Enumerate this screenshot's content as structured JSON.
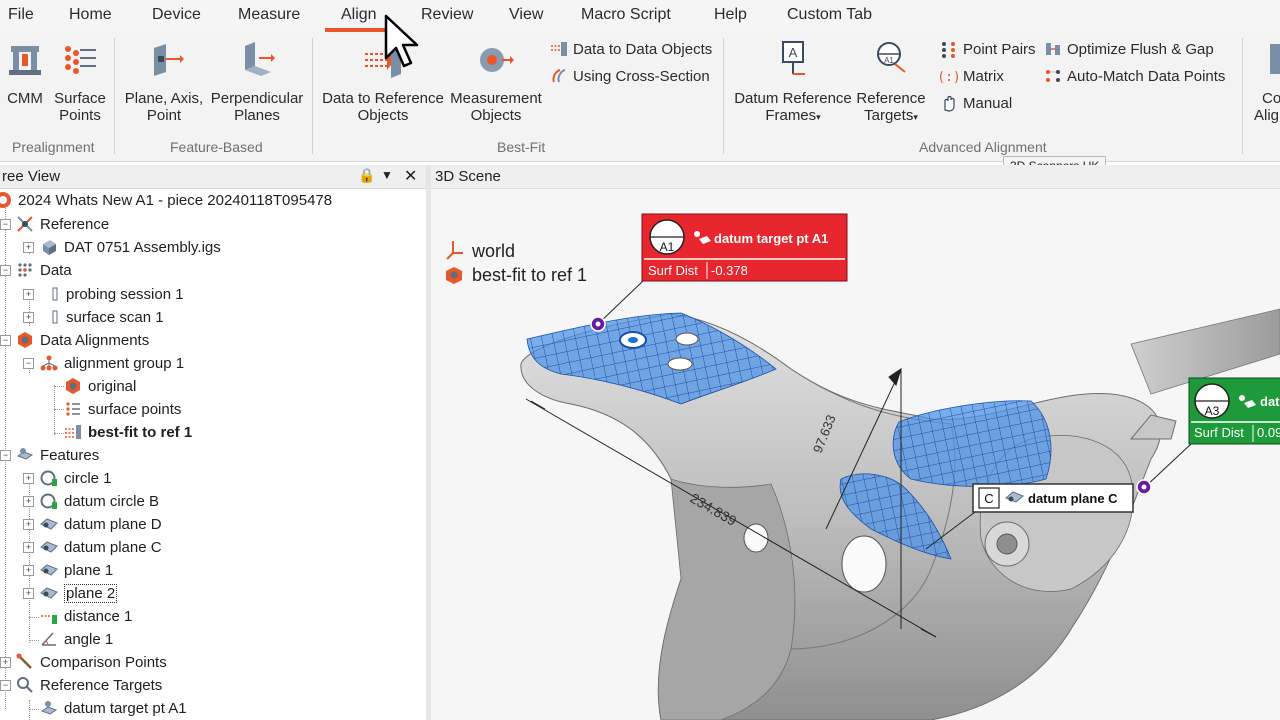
{
  "menu": {
    "tabs": [
      "File",
      "Home",
      "Device",
      "Measure",
      "Align",
      "Review",
      "View",
      "Macro Script",
      "Help",
      "Custom Tab"
    ],
    "active_tab": "Align"
  },
  "ribbon": {
    "prealignment": {
      "label": "Prealignment",
      "cmm": "CMM",
      "surface_points_1": "Surface",
      "surface_points_2": "Points"
    },
    "feature_based": {
      "label": "Feature-Based",
      "plane_axis_point_1": "Plane, Axis,",
      "plane_axis_point_2": "Point",
      "perpendicular_planes_1": "Perpendicular",
      "perpendicular_planes_2": "Planes"
    },
    "best_fit": {
      "label": "Best-Fit",
      "data_to_reference_1": "Data to Reference",
      "data_to_reference_2": "Objects",
      "measurement_objects_1": "Measurement",
      "measurement_objects_2": "Objects",
      "data_to_data": "Data to Data Objects",
      "cross_section": "Using Cross-Section"
    },
    "advanced": {
      "label": "Advanced Alignment",
      "datum_reference_frames_1": "Datum Reference",
      "datum_reference_frames_2": "Frames",
      "reference_targets_1": "Reference",
      "reference_targets_2": "Targets",
      "point_pairs": "Point Pairs",
      "matrix": "Matrix",
      "manual": "Manual",
      "optimize_flush_gap": "Optimize Flush & Gap",
      "auto_match": "Auto-Match Data Points"
    },
    "partial_1": "Co",
    "partial_2": "Alig",
    "tooltip": "3D Scanners UK"
  },
  "tree_view": {
    "title": "ree View",
    "root": "2024 Whats New A1 - piece 20240118T095478",
    "items": [
      {
        "label": "Reference"
      },
      {
        "label": "DAT 0751 Assembly.igs"
      },
      {
        "label": "Data"
      },
      {
        "label": "probing session 1"
      },
      {
        "label": "surface scan 1"
      },
      {
        "label": "Data Alignments"
      },
      {
        "label": "alignment group 1"
      },
      {
        "label": "original"
      },
      {
        "label": "surface points"
      },
      {
        "label": "best-fit to ref 1"
      },
      {
        "label": "Features"
      },
      {
        "label": "circle 1"
      },
      {
        "label": "datum circle B"
      },
      {
        "label": "datum plane D"
      },
      {
        "label": "datum plane C"
      },
      {
        "label": "plane 1"
      },
      {
        "label": "plane 2"
      },
      {
        "label": "distance 1"
      },
      {
        "label": "angle 1"
      },
      {
        "label": "Comparison Points"
      },
      {
        "label": "Reference Targets"
      },
      {
        "label": "datum target pt A1"
      }
    ]
  },
  "scene": {
    "title": "3D Scene",
    "legend_world": "world",
    "legend_bestfit": "best-fit to ref 1",
    "callout_a1": {
      "badge": "A1",
      "title": "datum target pt A1",
      "field": "Surf Dist",
      "value": "-0.378"
    },
    "callout_a3": {
      "badge": "A3",
      "title": "dat",
      "field": "Surf Dist",
      "value": "0.09"
    },
    "callout_c": {
      "badge": "C",
      "title": "datum plane C"
    },
    "dim_1": "234.839",
    "dim_2": "97.633"
  },
  "colors": {
    "accent": "#e8572a",
    "callout_red": "#e8262d",
    "callout_green": "#1f9a3a",
    "scan_blue": "#2f7fe0"
  }
}
